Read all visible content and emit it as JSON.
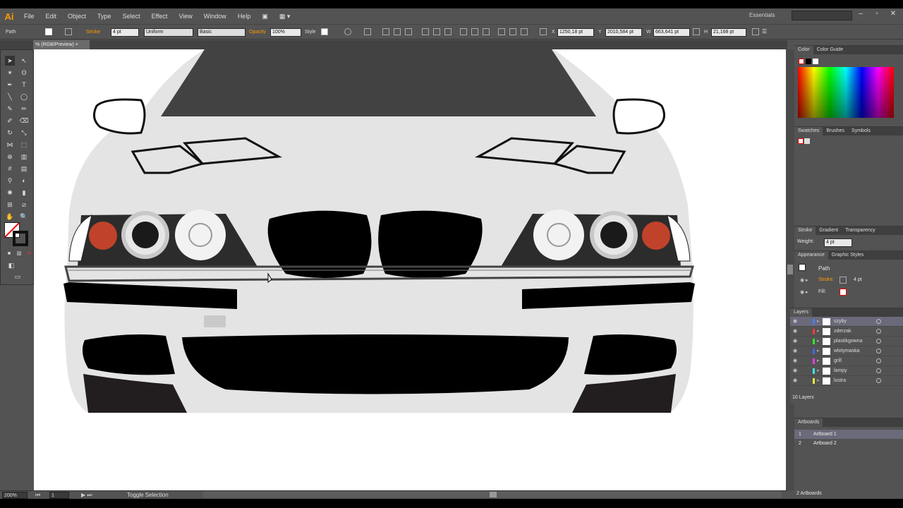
{
  "app": {
    "logo": "Ai",
    "workspace": "Essentials"
  },
  "menu": [
    "File",
    "Edit",
    "Object",
    "Type",
    "Select",
    "Effect",
    "View",
    "Window",
    "Help"
  ],
  "control": {
    "selection": "Path",
    "stroke_label": "Stroke",
    "stroke_weight": "4 pt",
    "profile": "Uniform",
    "brush": "Basic",
    "opacity_label": "Opacity",
    "opacity": "100%",
    "style_label": "Style",
    "x_label": "X",
    "x": "1250,18 pt",
    "y_label": "Y",
    "y": "2010,584 pt",
    "w_label": "W",
    "w": "663,641 pt",
    "h_label": "H",
    "h": "21,168 pt"
  },
  "doc": {
    "tab": "% (RGB/Preview)"
  },
  "status": {
    "zoom": "200%",
    "page": "1",
    "tool": "Toggle Selection"
  },
  "panels": {
    "color": {
      "tabs": [
        "Color",
        "Color Guide"
      ]
    },
    "swatches": {
      "tabs": [
        "Swatches",
        "Brushes",
        "Symbols"
      ]
    },
    "stroke": {
      "tabs": [
        "Stroke",
        "Gradient",
        "Transparency"
      ],
      "weight_label": "Weight:",
      "weight": "4 pt"
    },
    "appearance": {
      "tabs": [
        "Appearance",
        "Graphic Styles"
      ],
      "title": "Path",
      "stroke_label": "Stroke:",
      "stroke_val": "4 pt",
      "fill_label": "Fill:"
    },
    "layers": {
      "title": "Layers",
      "rows": [
        {
          "name": "szyby",
          "color": "#4a7bff"
        },
        {
          "name": "zderzak",
          "color": "#ff3a3a"
        },
        {
          "name": "plastikgowna",
          "color": "#2ee82e"
        },
        {
          "name": "wlotymaska",
          "color": "#3a6bff"
        },
        {
          "name": "grill",
          "color": "#e83ae8"
        },
        {
          "name": "lampy",
          "color": "#3ae8e8"
        },
        {
          "name": "lustra",
          "color": "#e8e83a"
        }
      ],
      "count": "10 Layers"
    },
    "artboards": {
      "title": "Artboards",
      "rows": [
        {
          "num": "1",
          "name": "Artboard 1"
        },
        {
          "num": "2",
          "name": "Artboard 2"
        }
      ],
      "count": "2 Artboards"
    }
  }
}
